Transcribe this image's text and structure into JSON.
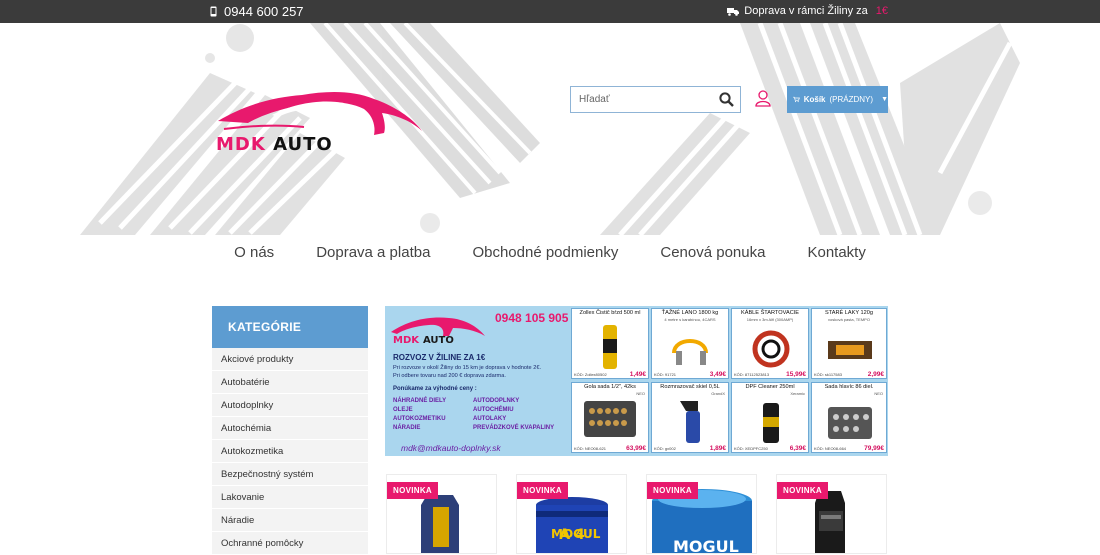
{
  "topbar": {
    "phone": "0944 600 257",
    "shipping": "Doprava v rámci Žiliny za",
    "shipping_highlight": "1€"
  },
  "header": {
    "logo_word1": "MDK",
    "logo_word2": "AUTO",
    "search_placeholder": "Hľadať",
    "cart_label": "Košík",
    "cart_status": "(PRÁZDNY)"
  },
  "nav": [
    "O nás",
    "Doprava a platba",
    "Obchodné podmienky",
    "Cenová ponuka",
    "Kontakty"
  ],
  "sidebar": {
    "title": "KATEGÓRIE",
    "items": [
      "Akciové produkty",
      "Autobatérie",
      "Autodoplnky",
      "Autochémia",
      "Autokozmetika",
      "Bezpečnostný systém",
      "Lakovanie",
      "Náradie",
      "Ochranné pomôcky"
    ]
  },
  "banner": {
    "phone": "0948 105 905",
    "heading": "ROZVOZ V ŽILINE ZA 1€",
    "line1": "Pri rozvoze v okolí Žiliny do 15 km je doprava v hodnote 2€.",
    "line2": "Pri odbere tovaru nad 200 € doprava zdarma.",
    "offer": "Ponúkame za výhodné ceny :",
    "items": [
      "NÁHRADNÉ DIELY",
      "AUTODOPLNKY",
      "OLEJE",
      "AUTOCHÉMIU",
      "AUTOKOZMETIKU",
      "AUTOLAKY",
      "NÁRADIE",
      "PREVÁDZKOVÉ KVAPALINY"
    ],
    "email": "mdk@mdkauto-doplnky.sk",
    "products": [
      {
        "name": "Zollex Čistič bŕzd 500 ml",
        "sub": "",
        "code": "KÓD: Zollex80502",
        "price": "1,49€"
      },
      {
        "name": "ŤAŽNÉ LANO 1800 kg",
        "sub": "4 metre s karabínou, 4CARS",
        "code": "KÓD: 91721",
        "price": "3,49€"
      },
      {
        "name": "KÁBLE ŠTARTOVACIE",
        "sub": "16mm x 3m Alfi (300AMP)",
        "code": "KÓD: 87112523813",
        "price": "15,99€"
      },
      {
        "name": "STARÉ LAKY 120g",
        "sub": "vosková pasta, TEMPO",
        "code": "KÓD: sk117583",
        "price": "2,99€"
      },
      {
        "name": "Gola sada 1/2\", 42ks",
        "sub": "NEO",
        "code": "KÓD: NEO08-621",
        "price": "63,99€"
      },
      {
        "name": "Rozmrazovač skiel 0,5L",
        "sub": "GrandX",
        "code": "KÓD: gx002",
        "price": "1,89€"
      },
      {
        "name": "DPF Cleaner 250ml",
        "sub": "Xeramic",
        "code": "KÓD: XEDPFC250",
        "price": "6,39€"
      },
      {
        "name": "Sada hlavíc 86 diel.",
        "sub": "NEO",
        "code": "KÓD: NEO08-664",
        "price": "79,99€"
      }
    ]
  },
  "cards": [
    {
      "badge": "NOVINKA",
      "label": ""
    },
    {
      "badge": "NOVINKA",
      "label": "MOGUL"
    },
    {
      "badge": "NOVINKA",
      "label": "MOGUL"
    },
    {
      "badge": "NOVINKA",
      "label": ""
    }
  ],
  "colors": {
    "accent": "#e8196d",
    "blue": "#5d9cd1",
    "topbar": "#3b3b3b"
  }
}
